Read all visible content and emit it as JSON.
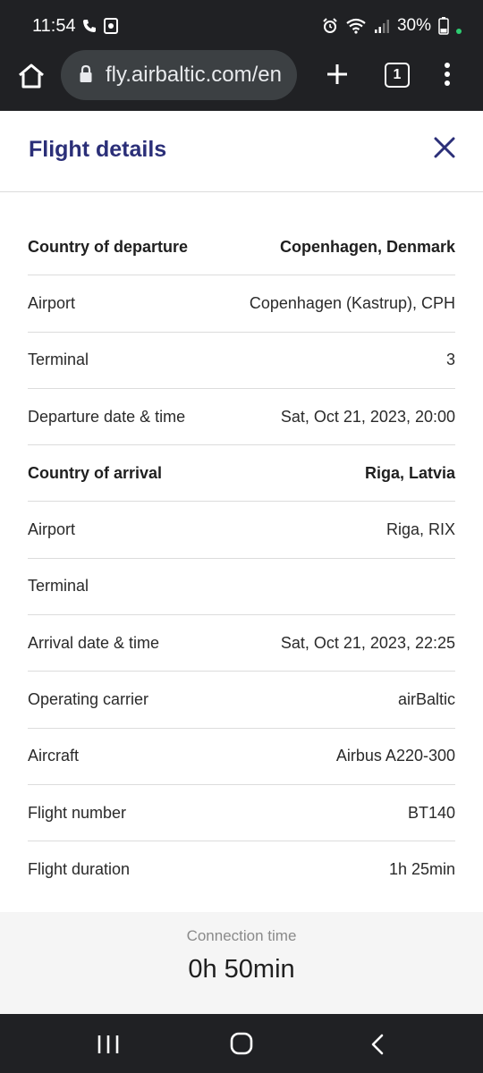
{
  "status_bar": {
    "time": "11:54",
    "battery": "30%",
    "icons": [
      "phone-icon",
      "screen-record-icon",
      "alarm-icon",
      "wifi-icon",
      "signal-icon",
      "battery-icon"
    ]
  },
  "browser": {
    "url": "fly.airbaltic.com/en",
    "tab_count": "1",
    "icons": [
      "home-icon",
      "lock-icon",
      "plus-icon",
      "tabs-icon",
      "more-menu-icon"
    ]
  },
  "page": {
    "title": "Flight details",
    "rows": [
      {
        "label": "Country of departure",
        "value": "Copenhagen, Denmark",
        "bold": true
      },
      {
        "label": "Airport",
        "value": "Copenhagen (Kastrup), CPH",
        "bold": false
      },
      {
        "label": "Terminal",
        "value": "3",
        "bold": false
      },
      {
        "label": "Departure date & time",
        "value": "Sat, Oct 21, 2023, 20:00",
        "bold": false
      },
      {
        "label": "Country of arrival",
        "value": "Riga, Latvia",
        "bold": true
      },
      {
        "label": "Airport",
        "value": "Riga, RIX",
        "bold": false
      },
      {
        "label": "Terminal",
        "value": "",
        "bold": false
      },
      {
        "label": "Arrival date & time",
        "value": "Sat, Oct 21, 2023, 22:25",
        "bold": false
      },
      {
        "label": "Operating carrier",
        "value": "airBaltic",
        "bold": false
      },
      {
        "label": "Aircraft",
        "value": "Airbus A220-300",
        "bold": false
      },
      {
        "label": "Flight number",
        "value": "BT140",
        "bold": false
      },
      {
        "label": "Flight duration",
        "value": "1h 25min",
        "bold": false
      }
    ],
    "connection": {
      "label": "Connection time",
      "value": "0h 50min"
    }
  },
  "colors": {
    "title": "#2b2f78",
    "chrome": "#202124",
    "urlbar": "#3c4043"
  }
}
